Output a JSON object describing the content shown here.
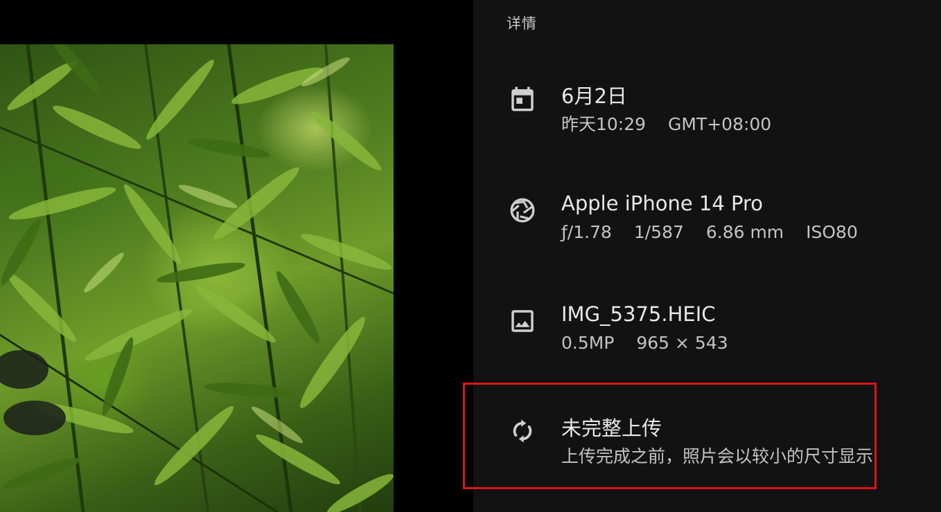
{
  "panel": {
    "title": "详情"
  },
  "date_row": {
    "icon": "calendar-icon",
    "primary": "6月2日",
    "time": "昨天10:29",
    "timezone": "GMT+08:00"
  },
  "camera_row": {
    "icon": "camera-aperture-icon",
    "primary": "Apple iPhone 14 Pro",
    "aperture": "ƒ/1.78",
    "shutter": "1/587",
    "focal_length": "6.86 mm",
    "iso": "ISO80"
  },
  "file_row": {
    "icon": "image-icon",
    "primary": "IMG_5375.HEIC",
    "megapixels": "0.5MP",
    "dimensions": "965 × 543"
  },
  "upload_row": {
    "icon": "sync-icon",
    "primary": "未完整上传",
    "secondary": "上传完成之前，照片会以较小的尺寸显示"
  },
  "colors": {
    "panel_bg": "#121212",
    "highlight": "#e0121a"
  }
}
